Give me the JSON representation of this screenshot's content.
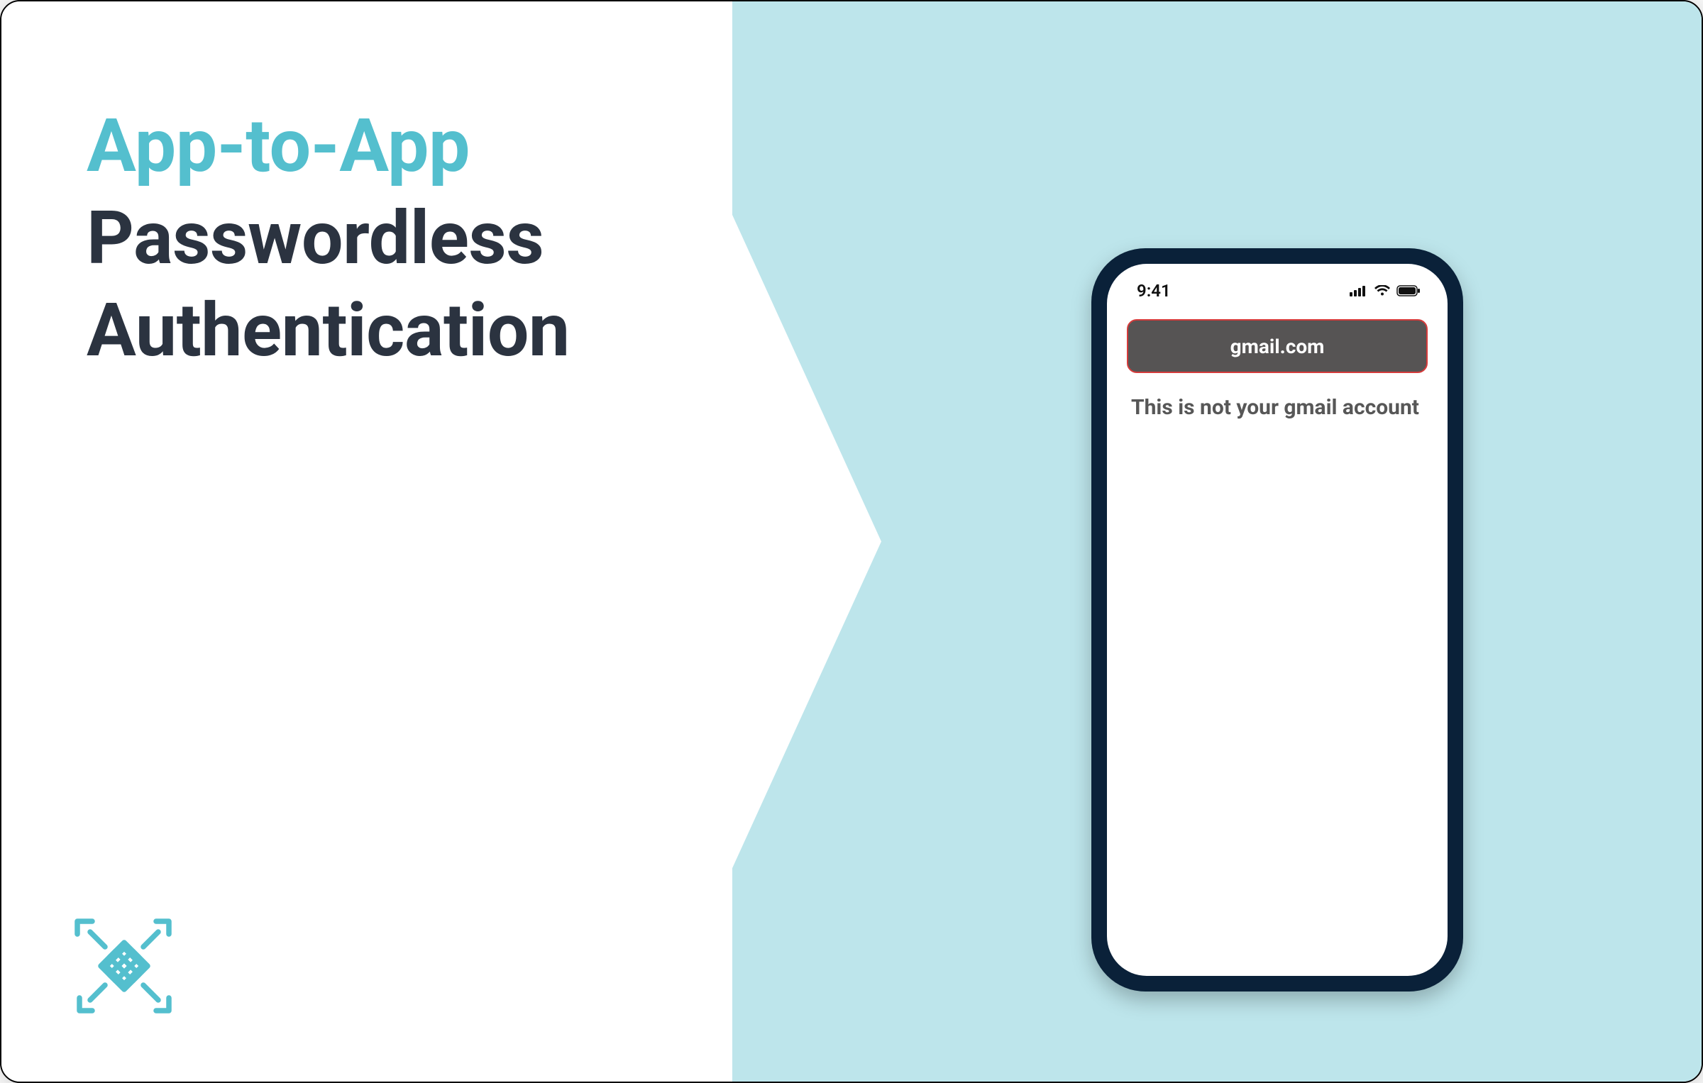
{
  "headline": {
    "line1": "App-to-App",
    "line2": "Passwordless",
    "line3": "Authentication"
  },
  "colors": {
    "accent": "#54bfce",
    "dark": "#2b3340",
    "panel": "#bde5eb",
    "phone_body": "#0a2139",
    "pill_bg": "#565454",
    "pill_border": "#d53b3b"
  },
  "phone": {
    "status": {
      "time": "9:41"
    },
    "domain_pill": "gmail.com",
    "warning_text": "This is not your gmail account"
  }
}
